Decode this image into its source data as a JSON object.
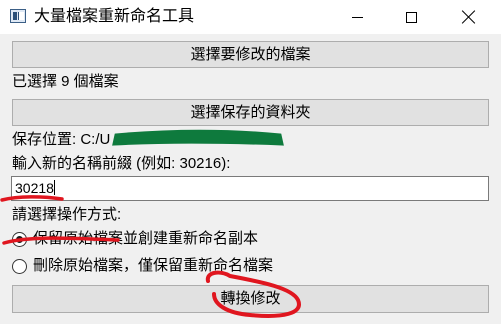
{
  "window": {
    "title": "大量檔案重新命名工具",
    "controls": [
      "minimize-icon",
      "maximize-icon",
      "close-icon"
    ]
  },
  "buttons": {
    "choose_files": "選擇要修改的檔案",
    "choose_folder": "選擇保存的資料夾",
    "convert": "轉換修改"
  },
  "status": {
    "selected_files": "已選擇 9 個檔案",
    "save_location": "保存位置: C:/U"
  },
  "prefix": {
    "label": "輸入新的名稱前綴 (例如: 30216):",
    "value": "30218"
  },
  "mode": {
    "label": "請選擇操作方式:",
    "options": [
      {
        "label": "保留原始檔案並創建重新命名副本",
        "checked": true
      },
      {
        "label": "刪除原始檔案，僅保留重新命名檔案",
        "checked": false
      }
    ]
  },
  "annotations": {
    "redaction_color": "#0e7a3d",
    "marker_color": "#e0161f"
  }
}
